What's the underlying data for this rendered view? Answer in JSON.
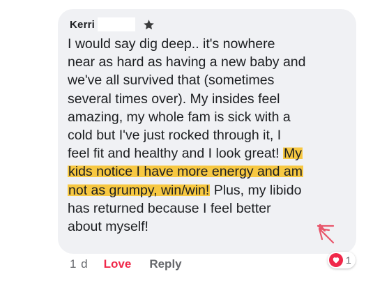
{
  "comment": {
    "author": "Kerri",
    "author_badge_icon": "top-fan-star-icon",
    "lines": [
      "I would say dig deep.. it's nowhere",
      "near as hard as having a new baby and",
      "we've all survived that (sometimes",
      "several times over). My insides feel",
      "amazing, my whole fam is sick with a",
      "cold but I've just rocked through it, I"
    ],
    "line7_plain": "feel fit and healthy and I look great! ",
    "line7_highlight": "My",
    "line8_highlight": "kids notice I have more energy and am",
    "line9_highlight": "not as grumpy, win/win!",
    "line9_plain": " Plus, my libido",
    "line10": "has returned because I feel better",
    "line11": "about myself!",
    "highlight_color": "#f7c842",
    "bubble_color": "#f0f1f4"
  },
  "actions": {
    "timestamp": "1 d",
    "love_label": "Love",
    "love_color": "#f0284a",
    "reply_label": "Reply"
  },
  "reactions": {
    "icon": "love-heart-icon",
    "count": "1"
  },
  "annotation": {
    "icon": "red-double-chevron-arrow-icon",
    "color": "#e8566b"
  }
}
